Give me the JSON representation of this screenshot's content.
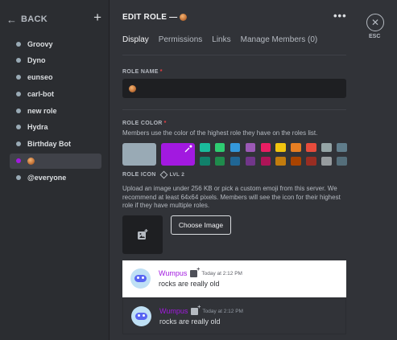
{
  "sidebar": {
    "back_label": "BACK",
    "roles": [
      {
        "name": "Groovy",
        "color": "#99aab5",
        "selected": false
      },
      {
        "name": "Dyno",
        "color": "#99aab5",
        "selected": false
      },
      {
        "name": "eunseo",
        "color": "#99aab5",
        "selected": false
      },
      {
        "name": "carl-bot",
        "color": "#99aab5",
        "selected": false
      },
      {
        "name": "new role",
        "color": "#99aab5",
        "selected": false
      },
      {
        "name": "Hydra",
        "color": "#99aab5",
        "selected": false
      },
      {
        "name": "Birthday Bot",
        "color": "#99aab5",
        "selected": false
      },
      {
        "name": "",
        "color": "#a219e0",
        "selected": true,
        "icon": "cookie-emoji-icon"
      },
      {
        "name": "@everyone",
        "color": "#99aab5",
        "selected": false
      }
    ]
  },
  "header": {
    "title": "EDIT ROLE —",
    "title_icon": "cookie-emoji-icon",
    "more_icon": "more-dots-icon",
    "esc_label": "ESC"
  },
  "tabs": [
    {
      "label": "Display",
      "active": true
    },
    {
      "label": "Permissions",
      "active": false
    },
    {
      "label": "Links",
      "active": false
    },
    {
      "label": "Manage Members (0)",
      "active": false
    }
  ],
  "role_name": {
    "label": "ROLE NAME",
    "required_mark": "*",
    "value_icon": "cookie-emoji-icon"
  },
  "role_color": {
    "label": "ROLE COLOR",
    "required_mark": "*",
    "help": "Members use the color of the highest role they have on the roles list.",
    "default_color": "#99aab5",
    "custom_color": "#a219e0",
    "palette": [
      "#1abc9c",
      "#2ecc71",
      "#3498db",
      "#9b59b6",
      "#e91e63",
      "#f1c40f",
      "#e67e22",
      "#e74c3c",
      "#95a5a6",
      "#607d8b",
      "#11806a",
      "#1f8b4c",
      "#206694",
      "#71368a",
      "#ad1457",
      "#c27c0e",
      "#a84300",
      "#992d22",
      "#979c9f",
      "#546e7a"
    ]
  },
  "role_icon": {
    "label": "ROLE ICON",
    "level_badge": "LVL 2",
    "help": "Upload an image under 256 KB or pick a custom emoji from this server. We recommend at least 64x64 pixels. Members will see the icon for their highest role if they have multiple roles.",
    "choose_button": "Choose Image"
  },
  "previews": [
    {
      "theme": "light",
      "username": "Wumpus",
      "timestamp": "Today at 2:12 PM",
      "message": "rocks are really old"
    },
    {
      "theme": "dark",
      "username": "Wumpus",
      "timestamp": "Today at 2:12 PM",
      "message": "rocks are really old"
    }
  ]
}
